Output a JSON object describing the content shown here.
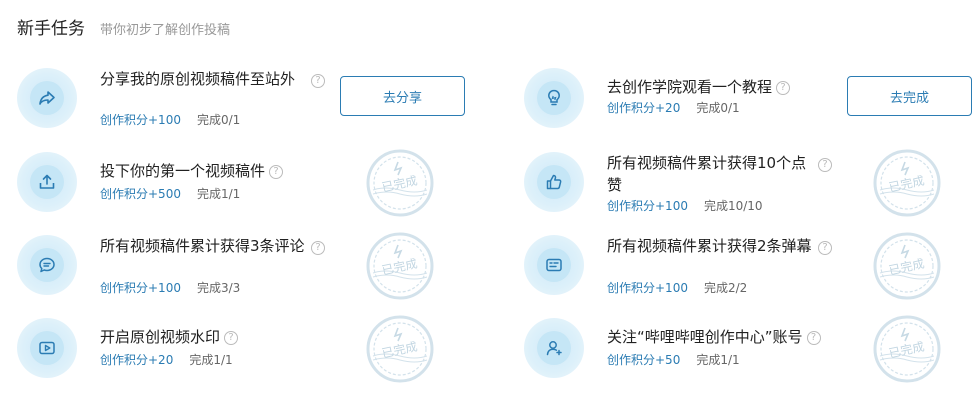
{
  "header": {
    "title": "新手任务",
    "subtitle": "带你初步了解创作投稿"
  },
  "help_glyph": "?",
  "stamp_text": "已完成",
  "tasks": [
    {
      "title": "分享我的原创视频稿件至站外",
      "points": "创作积分+100",
      "progress": "完成0/1",
      "icon": "share-arrow-icon",
      "action": "去分享"
    },
    {
      "title": "去创作学院观看一个教程",
      "points": "创作积分+20",
      "progress": "完成0/1",
      "icon": "lightbulb-icon",
      "action": "去完成"
    },
    {
      "title": "投下你的第一个视频稿件",
      "points": "创作积分+500",
      "progress": "完成1/1",
      "icon": "upload-icon",
      "status": "已完成"
    },
    {
      "title": "所有视频稿件累计获得10个点赞",
      "points": "创作积分+100",
      "progress": "完成10/10",
      "icon": "thumbs-up-icon",
      "status": "已完成"
    },
    {
      "title": "所有视频稿件累计获得3条评论",
      "points": "创作积分+100",
      "progress": "完成3/3",
      "icon": "comment-bubble-icon",
      "status": "已完成"
    },
    {
      "title": "所有视频稿件累计获得2条弹幕",
      "points": "创作积分+100",
      "progress": "完成2/2",
      "icon": "danmaku-icon",
      "status": "已完成"
    },
    {
      "title": "开启原创视频水印",
      "points": "创作积分+20",
      "progress": "完成1/1",
      "icon": "video-play-icon",
      "status": "已完成"
    },
    {
      "title": "关注“哔哩哔哩创作中心”账号",
      "points": "创作积分+50",
      "progress": "完成1/1",
      "icon": "follow-user-icon",
      "status": "已完成"
    }
  ],
  "colors": {
    "accent": "#2b7cb3",
    "icon_bg": "#dcf0fa",
    "stamp": "#c9dbe6"
  }
}
